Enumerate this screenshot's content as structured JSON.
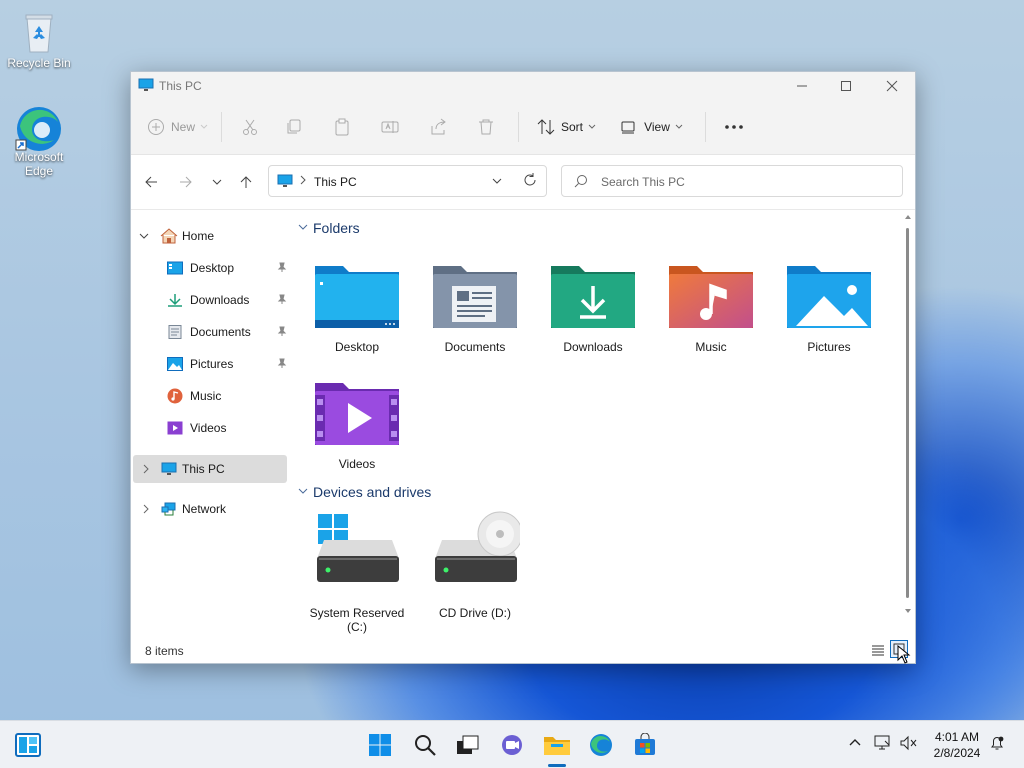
{
  "desktop": {
    "icons": [
      {
        "label": "Recycle Bin"
      },
      {
        "label": "Microsoft Edge"
      }
    ]
  },
  "window": {
    "title": "This PC",
    "toolbar": {
      "new_label": "New",
      "sort_label": "Sort",
      "view_label": "View"
    },
    "address": {
      "path": "This PC",
      "search_placeholder": "Search This PC"
    },
    "sidebar": {
      "home": "Home",
      "quick": [
        {
          "label": "Desktop",
          "pinned": true
        },
        {
          "label": "Downloads",
          "pinned": true
        },
        {
          "label": "Documents",
          "pinned": true
        },
        {
          "label": "Pictures",
          "pinned": true
        },
        {
          "label": "Music",
          "pinned": false
        },
        {
          "label": "Videos",
          "pinned": false
        }
      ],
      "this_pc": "This PC",
      "network": "Network"
    },
    "content": {
      "folders_header": "Folders",
      "folders": [
        {
          "label": "Desktop"
        },
        {
          "label": "Documents"
        },
        {
          "label": "Downloads"
        },
        {
          "label": "Music"
        },
        {
          "label": "Pictures"
        },
        {
          "label": "Videos"
        }
      ],
      "drives_header": "Devices and drives",
      "drives": [
        {
          "label": "System Reserved (C:)"
        },
        {
          "label": "CD Drive (D:)"
        }
      ]
    },
    "status": {
      "items": "8 items"
    }
  },
  "taskbar": {
    "time": "4:01 AM",
    "date": "2/8/2024"
  },
  "colors": {
    "accent": "#0f6cbd",
    "folder_blue": "#1aa3e8",
    "folder_green": "#1e9e7a",
    "folder_orange": "#e0623c",
    "folder_purple": "#8a3fd1",
    "selection": "#dcdcdc"
  }
}
